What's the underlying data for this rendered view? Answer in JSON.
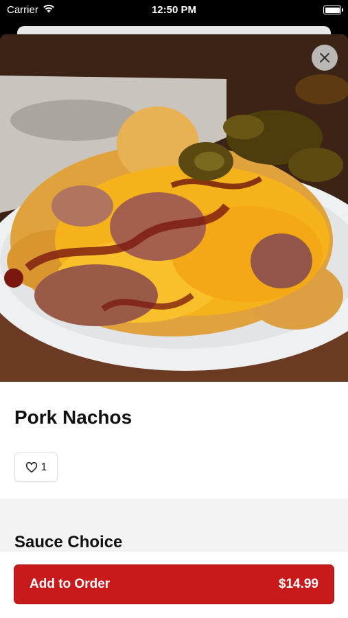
{
  "status_bar": {
    "carrier": "Carrier",
    "time": "12:50 PM"
  },
  "item": {
    "name": "Pork Nachos",
    "like_count": "1"
  },
  "sections": {
    "sauce_title": "Sauce Choice"
  },
  "footer": {
    "add_label": "Add to Order",
    "price": "$14.99"
  },
  "colors": {
    "accent": "#c8191b",
    "background": "#f3f3f3"
  },
  "icons": {
    "close": "close-icon",
    "like": "heart-icon",
    "wifi": "wifi-icon",
    "battery": "battery-icon"
  }
}
